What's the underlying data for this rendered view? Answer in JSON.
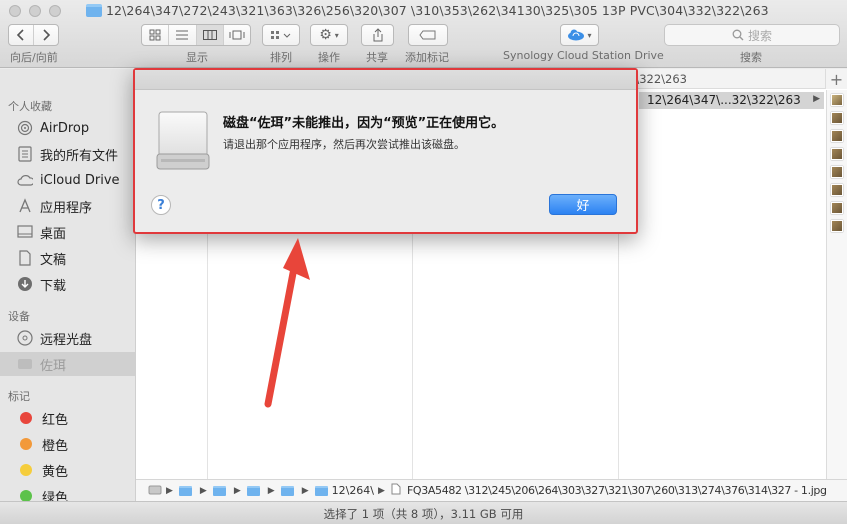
{
  "window": {
    "title": "12\\264\\347\\272\\243\\321\\363\\326\\256\\320\\307 \\310\\353\\262\\34130\\325\\305 13P PVC\\304\\332\\322\\263"
  },
  "toolbar": {
    "back_icon": "chevron-left-icon",
    "forward_icon": "chevron-right-icon",
    "nav_label": "向后/向前",
    "view_label": "显示",
    "sort_label": "排列",
    "action_label": "操作",
    "share_label": "共享",
    "tag_label": "添加标记",
    "cloud_label": "Synology Cloud Station Drive",
    "search_label": "搜索",
    "search_placeholder": "搜索"
  },
  "sidebar": {
    "favorites_header": "个人收藏",
    "favorites": [
      {
        "label": "AirDrop",
        "icon": "airdrop-icon"
      },
      {
        "label": "我的所有文件",
        "icon": "all-files-icon"
      },
      {
        "label": "iCloud Drive",
        "icon": "cloud-icon"
      },
      {
        "label": "应用程序",
        "icon": "applications-icon"
      },
      {
        "label": "桌面",
        "icon": "desktop-icon"
      },
      {
        "label": "文稿",
        "icon": "document-icon"
      },
      {
        "label": "下载",
        "icon": "download-icon"
      }
    ],
    "devices_header": "设备",
    "devices": [
      {
        "label": "远程光盘",
        "icon": "optical-disc-icon"
      },
      {
        "label": "佐珥",
        "icon": "drive-icon",
        "selected": true
      }
    ],
    "tags_header": "标记",
    "tags": [
      {
        "label": "红色",
        "color": "#e8463c"
      },
      {
        "label": "橙色",
        "color": "#f2993a"
      },
      {
        "label": "黄色",
        "color": "#f5cd3c"
      },
      {
        "label": "绿色",
        "color": "#5cc24a"
      }
    ]
  },
  "browser": {
    "path_strip": "2\\322\\263",
    "selected_row": "12\\264\\347\\...32\\322\\263",
    "plus_label": "+"
  },
  "pathbar": {
    "folder_label": "12\\264\\",
    "file_label": "FQ3A5482 \\312\\245\\206\\264\\303\\327\\321\\307\\260\\313\\274\\376\\314\\327 - 1.jpg"
  },
  "status": {
    "text": "选择了 1 项（共 8 项），3.11 GB 可用"
  },
  "dialog": {
    "title": "磁盘“佐珥”未能推出，因为“预览”正在使用它。",
    "message": "请退出那个应用程序，然后再次尝试推出该磁盘。",
    "help_label": "?",
    "ok_label": "好",
    "accent_color": "#2c82f2",
    "highlight_color": "#e0393c"
  }
}
